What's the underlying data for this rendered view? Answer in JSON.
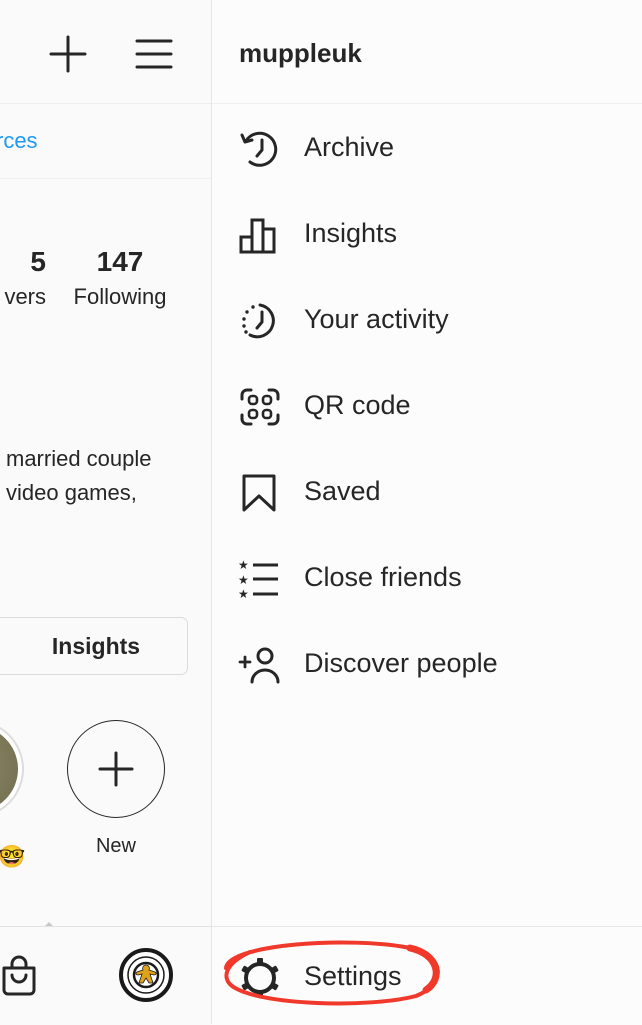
{
  "profile_panel": {
    "resources_link": "rces",
    "stats": [
      {
        "value": "5",
        "label": "vers"
      },
      {
        "value": "147",
        "label": "Following"
      }
    ],
    "bio_lines": [
      "married couple",
      "video games,"
    ],
    "insights_button": "Insights",
    "highlights": [
      {
        "label_emoji": "🤓"
      },
      {
        "label": "New"
      }
    ],
    "bottom_nav": {
      "shop_icon": "shopping-bag-icon",
      "profile_icon": "profile-avatar"
    }
  },
  "menu_panel": {
    "username": "muppleuk",
    "items": [
      {
        "label": "Archive",
        "icon": "archive-icon"
      },
      {
        "label": "Insights",
        "icon": "insights-icon"
      },
      {
        "label": "Your activity",
        "icon": "activity-icon"
      },
      {
        "label": "QR code",
        "icon": "qr-code-icon"
      },
      {
        "label": "Saved",
        "icon": "bookmark-icon"
      },
      {
        "label": "Close friends",
        "icon": "close-friends-icon"
      },
      {
        "label": "Discover people",
        "icon": "add-person-icon"
      }
    ],
    "settings": {
      "label": "Settings",
      "icon": "gear-icon"
    }
  },
  "annotation": {
    "color": "#f0392b",
    "target": "Settings"
  },
  "colors": {
    "link": "#1d9bf0",
    "text": "#262626",
    "divider": "#e6e6e6"
  }
}
